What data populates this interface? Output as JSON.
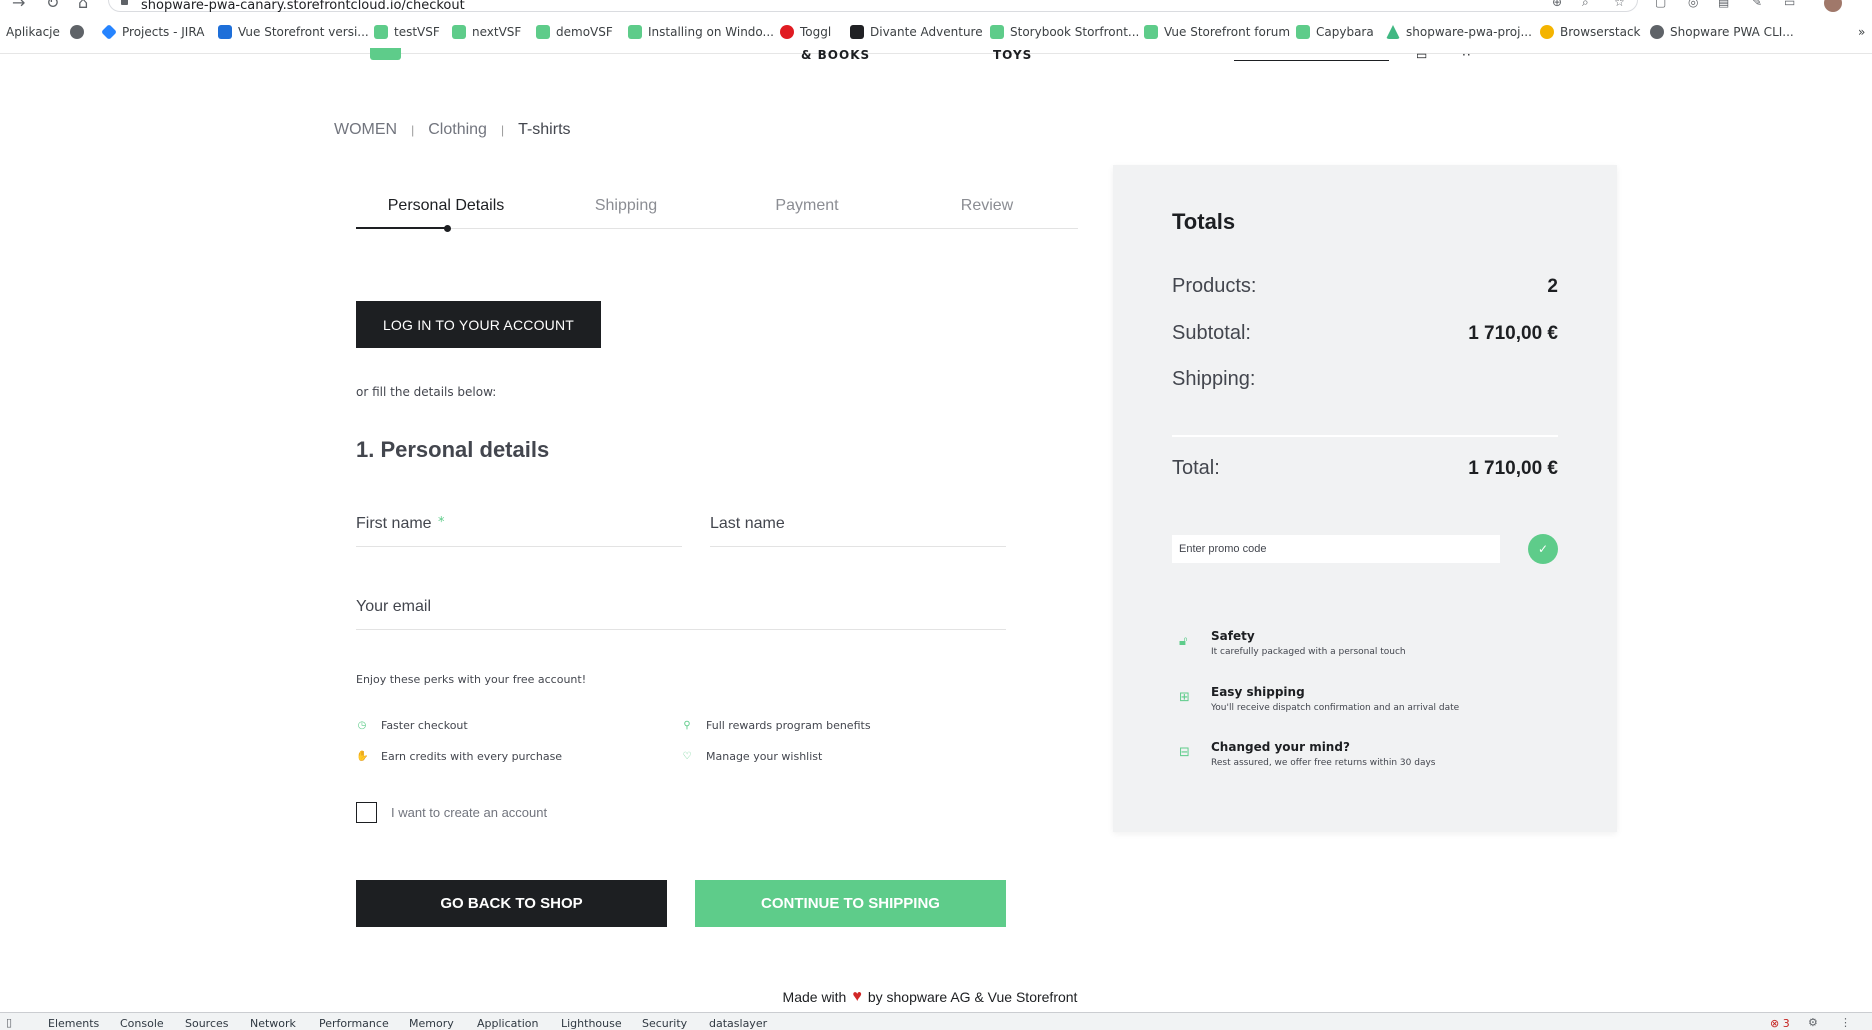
{
  "browser": {
    "url": "shopware-pwa-canary.storefrontcloud.io/checkout",
    "bookmarks_label": "Aplikacje",
    "bookmarks": [
      "Projects - JIRA",
      "Vue Storefront versi...",
      "testVSF",
      "nextVSF",
      "demoVSF",
      "Installing on Windo...",
      "Toggl",
      "Divante Adventure",
      "Storybook Storfront...",
      "Vue Storefront forum",
      "Capybara",
      "shopware-pwa-proj...",
      "Browserstack",
      "Shopware PWA CLI..."
    ]
  },
  "header_ghost": {
    "nav_books": "& BOOKS",
    "nav_toys": "TOYS"
  },
  "breadcrumbs": [
    "WOMEN",
    "Clothing",
    "T-shirts"
  ],
  "steps": [
    "Personal Details",
    "Shipping",
    "Payment",
    "Review"
  ],
  "login_button": "LOG IN TO YOUR ACCOUNT",
  "fill_note": "or fill the details below:",
  "section_title": "1. Personal details",
  "form": {
    "first_name_placeholder": "First name",
    "required_mark": "*",
    "last_name_placeholder": "Last name",
    "email_placeholder": "Your email"
  },
  "perks": {
    "title": "Enjoy these perks with your free account!",
    "items": [
      {
        "label": "Faster checkout",
        "icon": "clock-icon"
      },
      {
        "label": "Full rewards program benefits",
        "icon": "rewards-icon"
      },
      {
        "label": "Earn credits with every purchase",
        "icon": "credits-icon"
      },
      {
        "label": "Manage your wishlist",
        "icon": "heart-icon"
      }
    ]
  },
  "create_account_label": "I want to create an account",
  "buttons": {
    "back": "GO BACK TO SHOP",
    "continue": "CONTINUE TO SHIPPING"
  },
  "footer": {
    "made_with": "Made with",
    "by": "by shopware AG & Vue Storefront"
  },
  "totals": {
    "title": "Totals",
    "products_label": "Products:",
    "products_value": "2",
    "subtotal_label": "Subtotal:",
    "subtotal_value": "1 710,00 €",
    "shipping_label": "Shipping:",
    "shipping_value": "",
    "total_label": "Total:",
    "total_value": "1 710,00 €",
    "promo_placeholder": "Enter promo code",
    "properties": [
      {
        "title": "Safety",
        "desc": "It carefully packaged with a personal touch",
        "icon": "lock-icon"
      },
      {
        "title": "Easy shipping",
        "desc": "You'll receive dispatch confirmation and an arrival date",
        "icon": "box-icon"
      },
      {
        "title": "Changed your mind?",
        "desc": "Rest assured, we offer free returns within 30 days",
        "icon": "return-icon"
      }
    ]
  },
  "devtools": {
    "tabs": [
      "Elements",
      "Console",
      "Sources",
      "Network",
      "Performance",
      "Memory",
      "Application",
      "Lighthouse",
      "Security",
      "dataslayer"
    ],
    "error_count": "3"
  },
  "colors": {
    "primary": "#5ecc8a",
    "dark": "#1d1f22",
    "panel": "#f1f2f3"
  }
}
